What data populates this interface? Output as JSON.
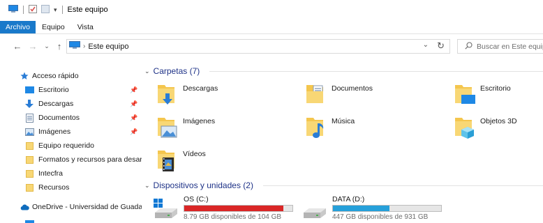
{
  "window": {
    "title": "Este equipo"
  },
  "ribbon": {
    "tabs": [
      "Archivo",
      "Equipo",
      "Vista"
    ]
  },
  "navbar": {
    "address": "Este equipo",
    "search_placeholder": "Buscar en Este equipo"
  },
  "sidebar": {
    "quick_access": "Acceso rápido",
    "items": [
      {
        "label": "Escritorio",
        "icon": "desktop-icon",
        "pinned": true
      },
      {
        "label": "Descargas",
        "icon": "download-arrow-icon",
        "pinned": true
      },
      {
        "label": "Documentos",
        "icon": "document-icon",
        "pinned": true
      },
      {
        "label": "Imágenes",
        "icon": "pictures-icon",
        "pinned": true
      },
      {
        "label": "Equipo requerido",
        "icon": "folder-icon",
        "pinned": false
      },
      {
        "label": "Formatos y recursos para desarrol",
        "icon": "folder-icon",
        "pinned": false
      },
      {
        "label": "Intecfra",
        "icon": "folder-icon",
        "pinned": false
      },
      {
        "label": "Recursos",
        "icon": "folder-icon",
        "pinned": false
      }
    ],
    "onedrive": "OneDrive - Universidad de Guadalaj"
  },
  "main": {
    "folders_header": "Carpetas (7)",
    "folders": [
      {
        "label": "Descargas",
        "icon": "downloads-folder-icon"
      },
      {
        "label": "Documentos",
        "icon": "documents-folder-icon"
      },
      {
        "label": "Escritorio",
        "icon": "desktop-folder-icon"
      },
      {
        "label": "Imágenes",
        "icon": "pictures-folder-icon"
      },
      {
        "label": "Música",
        "icon": "music-folder-icon"
      },
      {
        "label": "Objetos 3D",
        "icon": "3d-objects-folder-icon"
      },
      {
        "label": "Vídeos",
        "icon": "videos-folder-icon"
      }
    ],
    "drives_header": "Dispositivos y unidades (2)",
    "drives": [
      {
        "name": "OS (C:)",
        "free_text": "8.79 GB disponibles de 104 GB",
        "used_fraction": 0.915,
        "bar_color": "#da2626"
      },
      {
        "name": "DATA (D:)",
        "free_text": "447 GB disponibles de 931 GB",
        "used_fraction": 0.52,
        "bar_color": "#26a0da"
      }
    ]
  },
  "colors": {
    "accent": "#1979ca",
    "group_header": "#1e3287",
    "folder": "#f8d775"
  }
}
